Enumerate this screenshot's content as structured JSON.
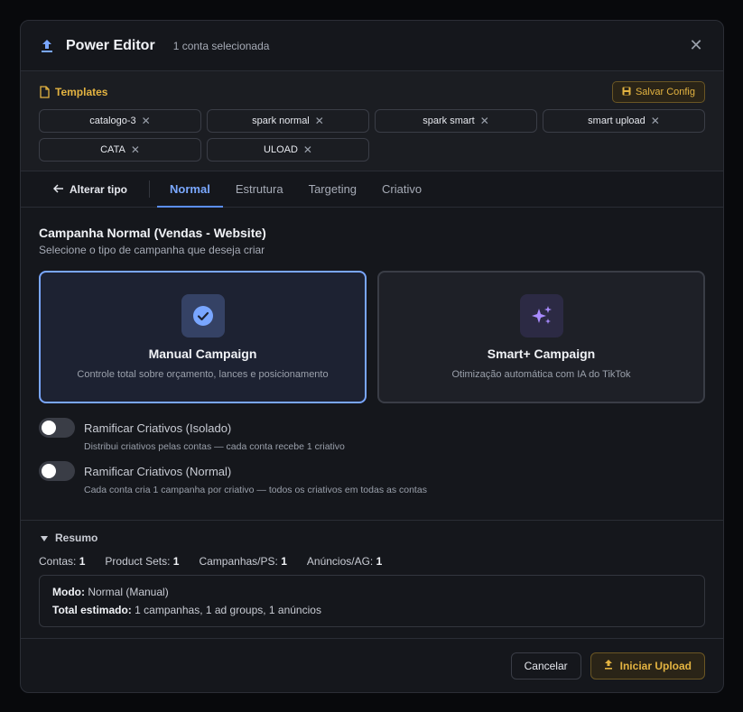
{
  "header": {
    "title": "Power Editor",
    "subtitle": "1 conta selecionada"
  },
  "templates": {
    "label": "Templates",
    "save_label": "Salvar Config",
    "chips": [
      {
        "label": "catalogo-3"
      },
      {
        "label": "spark normal"
      },
      {
        "label": "spark smart"
      },
      {
        "label": "smart upload"
      },
      {
        "label": "CATA"
      },
      {
        "label": "ULOAD"
      }
    ]
  },
  "tabs": {
    "back_label": "Alterar tipo",
    "items": [
      {
        "label": "Normal",
        "active": true
      },
      {
        "label": "Estrutura",
        "active": false
      },
      {
        "label": "Targeting",
        "active": false
      },
      {
        "label": "Criativo",
        "active": false
      }
    ]
  },
  "campaign": {
    "title": "Campanha Normal (Vendas - Website)",
    "subtitle": "Selecione o tipo de campanha que deseja criar",
    "cards": [
      {
        "title": "Manual Campaign",
        "desc": "Controle total sobre orçamento, lances e posicionamento",
        "selected": true,
        "icon": "check-circle-icon"
      },
      {
        "title": "Smart+ Campaign",
        "desc": "Otimização automática com IA do TikTok",
        "selected": false,
        "icon": "sparkles-icon"
      }
    ]
  },
  "toggles": [
    {
      "title": "Ramificar Criativos (Isolado)",
      "desc": "Distribui criativos pelas contas — cada conta recebe 1 criativo",
      "on": false
    },
    {
      "title": "Ramificar Criativos (Normal)",
      "desc": "Cada conta cria 1 campanha por criativo — todos os criativos em todas as contas",
      "on": false
    }
  ],
  "summary": {
    "title": "Resumo",
    "stats": [
      {
        "label": "Contas:",
        "value": "1"
      },
      {
        "label": "Product Sets:",
        "value": "1"
      },
      {
        "label": "Campanhas/PS:",
        "value": "1"
      },
      {
        "label": "Anúncios/AG:",
        "value": "1"
      }
    ],
    "mode_label": "Modo:",
    "mode_value": "Normal (Manual)",
    "total_label": "Total estimado:",
    "total_value": "1 campanhas, 1 ad groups, 1 anúncios"
  },
  "footer": {
    "cancel_label": "Cancelar",
    "upload_label": "Iniciar Upload"
  },
  "colors": {
    "accent_blue": "#79a6ff",
    "accent_gold": "#e3b341",
    "modal_bg": "#15171c"
  }
}
